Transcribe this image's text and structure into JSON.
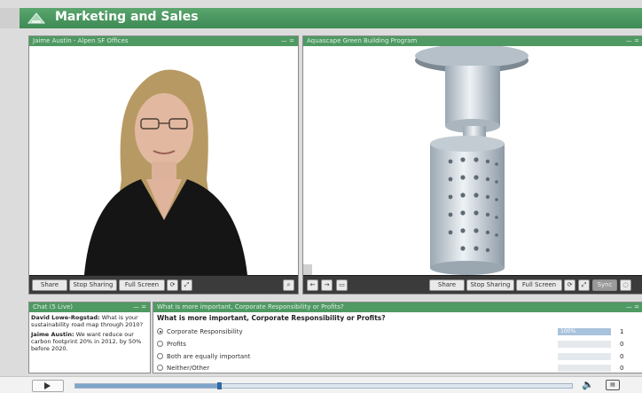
{
  "app": {
    "title": "Marketing and Sales"
  },
  "video_pane": {
    "title": "Jaime Austin - Alpen SF Offices",
    "controls": "— =",
    "toolbar": {
      "share_label": "Share",
      "stop_sharing_label": "Stop Sharing",
      "full_screen_label": "Full Screen"
    }
  },
  "model_pane": {
    "title": "Aquascape Green Building Program",
    "controls": "— =",
    "toolbar": {
      "share_label": "Share",
      "stop_sharing_label": "Stop Sharing",
      "full_screen_label": "Full Screen",
      "sync_label": "Sync"
    }
  },
  "chat": {
    "title": "Chat (5 Live)",
    "controls": "— =",
    "messages": [
      {
        "name": "David Lowe-Rogstad:",
        "text": "What is your sustainability road map through 2010?"
      },
      {
        "name": "Jaime Austin:",
        "text": "We want reduce our carbon footprint 20% in 2012, by 50% before 2020."
      }
    ]
  },
  "poll": {
    "title": "What is more important, Corporate Responsibility or Profits?",
    "controls": "— =",
    "question": "What is more important, Corporate Responsibility or Profits?",
    "options": [
      {
        "label": "Corporate Responsibility",
        "selected": true,
        "percent": 100,
        "percent_label": "100%",
        "count": "1"
      },
      {
        "label": "Profits",
        "selected": false,
        "percent": 0,
        "percent_label": "",
        "count": "0"
      },
      {
        "label": "Both are equally important",
        "selected": false,
        "percent": 0,
        "percent_label": "",
        "count": "0"
      },
      {
        "label": "Neither/Other",
        "selected": false,
        "percent": 0,
        "percent_label": "",
        "count": "0"
      }
    ]
  },
  "player": {
    "progress": 0.29
  }
}
